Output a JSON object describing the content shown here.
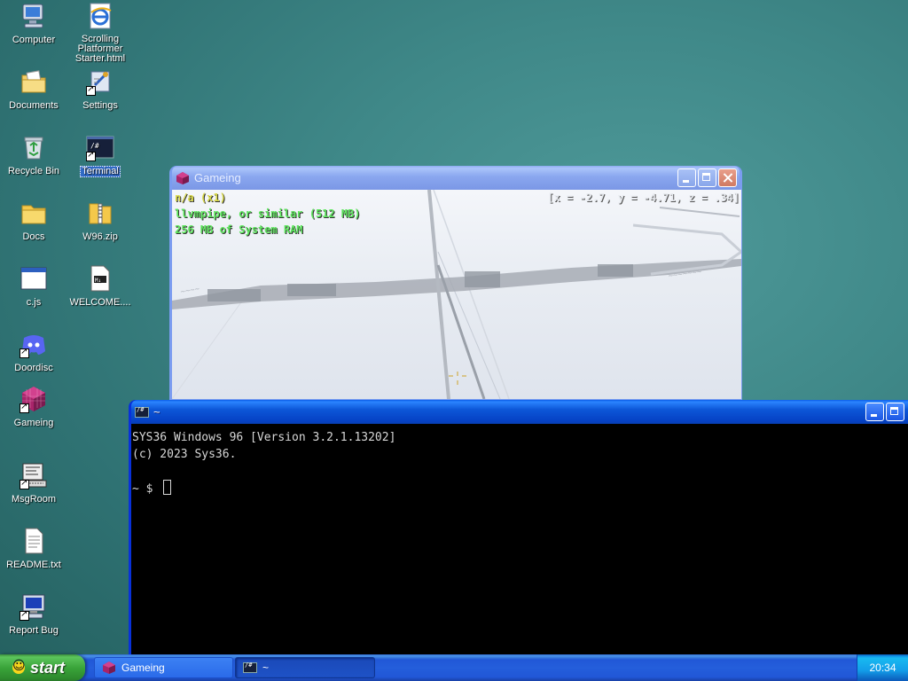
{
  "desktop": {
    "icons": [
      {
        "label": "Computer",
        "icon": "computer-icon"
      },
      {
        "label": "Scrolling Platformer Starter.html",
        "icon": "internet-explorer-icon"
      },
      {
        "label": "Documents",
        "icon": "documents-folder-icon"
      },
      {
        "label": "Settings",
        "icon": "settings-icon"
      },
      {
        "label": "Recycle Bin",
        "icon": "recycle-bin-icon"
      },
      {
        "label": "Terminal",
        "icon": "terminal-icon"
      },
      {
        "label": "Docs",
        "icon": "folder-icon"
      },
      {
        "label": "W96.zip",
        "icon": "zip-folder-icon"
      },
      {
        "label": "c.js",
        "icon": "window-app-icon"
      },
      {
        "label": "WELCOME....",
        "icon": "markdown-file-icon"
      },
      {
        "label": "Doordisc",
        "icon": "discord-icon"
      },
      {
        "label": "Gameing",
        "icon": "cube-icon"
      },
      {
        "label": "MsgRoom",
        "icon": "msgroom-icon"
      },
      {
        "label": "README.txt",
        "icon": "text-file-icon"
      },
      {
        "label": "Report Bug",
        "icon": "report-bug-icon"
      }
    ],
    "selected": "Terminal"
  },
  "game_window": {
    "title": "Gameing",
    "hud": {
      "line1": "n/a (x1)",
      "line2": "llvmpipe, or similar (512 MB)",
      "line3": "256 MB of System RAM",
      "coords": "[x = -2.7, y = -4.71, z = .34]"
    },
    "colors": {
      "hud_yellow": "#d8d84a",
      "hud_green": "#5fe65f"
    }
  },
  "terminal_window": {
    "title": "~",
    "lines": [
      "SYS36 Windows 96 [Version 3.2.1.13202]",
      "(c) 2023 Sys36.",
      "",
      "~ $ "
    ]
  },
  "taskbar": {
    "start_label": "start",
    "tasks": [
      {
        "label": "Gameing",
        "icon": "cube-icon"
      },
      {
        "label": "~",
        "icon": "terminal-icon"
      }
    ],
    "clock": "20:34"
  }
}
